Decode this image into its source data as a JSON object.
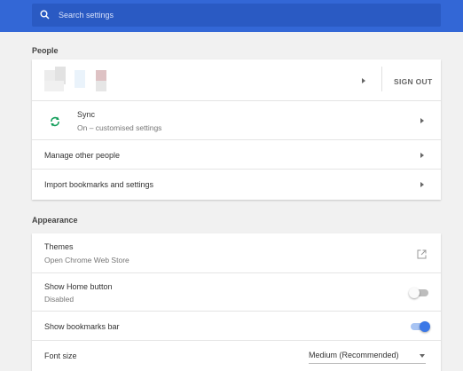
{
  "search": {
    "placeholder": "Search settings"
  },
  "people": {
    "section_title": "People",
    "sign_out_label": "SIGN OUT",
    "sync": {
      "title": "Sync",
      "subtitle": "On – customised settings"
    },
    "manage_label": "Manage other people",
    "import_label": "Import bookmarks and settings"
  },
  "appearance": {
    "section_title": "Appearance",
    "themes": {
      "title": "Themes",
      "subtitle": "Open Chrome Web Store"
    },
    "home_button": {
      "title": "Show Home button",
      "subtitle": "Disabled",
      "enabled": false
    },
    "bookmarks_bar": {
      "title": "Show bookmarks bar",
      "enabled": true
    },
    "font_size": {
      "title": "Font size",
      "value": "Medium (Recommended)"
    }
  },
  "colors": {
    "accent": "#3367d6",
    "toggle_on": "#3b78e7",
    "sync_icon": "#0f9d58"
  }
}
